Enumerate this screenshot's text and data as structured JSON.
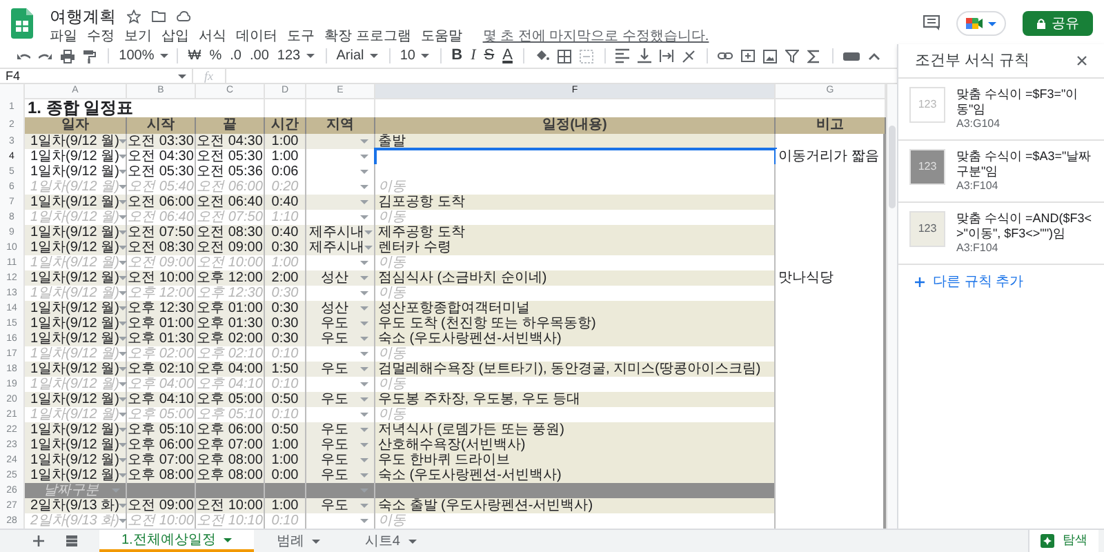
{
  "document": {
    "title": "여행계획",
    "last_edit": "몇 초 전에 마지막으로 수정했습니다."
  },
  "menu": [
    "파일",
    "수정",
    "보기",
    "삽입",
    "서식",
    "데이터",
    "도구",
    "확장 프로그램",
    "도움말"
  ],
  "share_button": "공유",
  "toolbar": {
    "zoom": "100%",
    "currency": "₩",
    "percent": "%",
    "decrease_decimal": ".0",
    "increase_decimal": ".00",
    "number_format": "123",
    "font": "Arial",
    "font_size": "10",
    "bold": "B",
    "italic": "I",
    "strike": "S",
    "text_color": "A"
  },
  "formula_bar": {
    "name_box": "F4",
    "fx": "fx"
  },
  "sheet": {
    "columns": [
      {
        "letter": "A",
        "selected": false
      },
      {
        "letter": "B",
        "selected": false
      },
      {
        "letter": "C",
        "selected": false
      },
      {
        "letter": "D",
        "selected": false
      },
      {
        "letter": "E",
        "selected": false
      },
      {
        "letter": "F",
        "selected": true
      },
      {
        "letter": "G",
        "selected": false
      }
    ],
    "title_row": {
      "number": "1",
      "text": "1. 종합 일정표"
    },
    "header_row": {
      "number": "2",
      "cells": [
        "일자",
        "시작",
        "끝",
        "시간",
        "지역",
        "일정(내용)",
        "비고"
      ]
    },
    "rows": [
      {
        "number": "3",
        "kind": "schedule",
        "date": "1일차(9/12 월)",
        "start": "오전 03:30",
        "end": "오전 04:30",
        "duration": "1:00",
        "plan": "출발",
        "selected": false
      },
      {
        "number": "4",
        "kind": "blank",
        "date": "1일차(9/12 월)",
        "start": "오전 04:30",
        "end": "오전 05:30",
        "duration": "1:00",
        "note": "이동거리가 짧음",
        "selected": true
      },
      {
        "number": "5",
        "kind": "blank",
        "date": "1일차(9/12 월)",
        "start": "오전 05:30",
        "end": "오전 05:36",
        "duration": "0:06",
        "selected": false
      },
      {
        "number": "6",
        "kind": "move",
        "date": "1일차(9/12 월)",
        "start": "오전 05:40",
        "end": "오전 06:00",
        "duration": "0:20",
        "plan": "이동",
        "selected": false
      },
      {
        "number": "7",
        "kind": "schedule",
        "date": "1일차(9/12 월)",
        "start": "오전 06:00",
        "end": "오전 06:40",
        "duration": "0:40",
        "plan": "김포공항 도착",
        "selected": false
      },
      {
        "number": "8",
        "kind": "move",
        "date": "1일차(9/12 월)",
        "start": "오전 06:40",
        "end": "오전 07:50",
        "duration": "1:10",
        "plan": "이동",
        "selected": false
      },
      {
        "number": "9",
        "kind": "schedule",
        "date": "1일차(9/12 월)",
        "start": "오전 07:50",
        "end": "오전 08:30",
        "duration": "0:40",
        "region": "제주시내",
        "plan": "제주공항 도착",
        "selected": false
      },
      {
        "number": "10",
        "kind": "schedule",
        "date": "1일차(9/12 월)",
        "start": "오전 08:30",
        "end": "오전 09:00",
        "duration": "0:30",
        "region": "제주시내",
        "plan": "렌터카 수령",
        "selected": false
      },
      {
        "number": "11",
        "kind": "move",
        "date": "1일차(9/12 월)",
        "start": "오전 09:00",
        "end": "오전 10:00",
        "duration": "1:00",
        "plan": "이동",
        "selected": false
      },
      {
        "number": "12",
        "kind": "schedule",
        "date": "1일차(9/12 월)",
        "start": "오전 10:00",
        "end": "오후 12:00",
        "duration": "2:00",
        "region": "성산",
        "plan": "점심식사 (소금바치 순이네)",
        "note": "맛나식당",
        "selected": false
      },
      {
        "number": "13",
        "kind": "move",
        "date": "1일차(9/12 월)",
        "start": "오후 12:00",
        "end": "오후 12:30",
        "duration": "0:30",
        "plan": "이동",
        "selected": false
      },
      {
        "number": "14",
        "kind": "schedule",
        "date": "1일차(9/12 월)",
        "start": "오후 12:30",
        "end": "오후 01:00",
        "duration": "0:30",
        "region": "성산",
        "plan": "성산포항종합여객터미널",
        "selected": false
      },
      {
        "number": "15",
        "kind": "schedule",
        "date": "1일차(9/12 월)",
        "start": "오후 01:00",
        "end": "오후 01:30",
        "duration": "0:30",
        "region": "우도",
        "plan": "우도 도착 (천진항 또는 하우목동항)",
        "selected": false
      },
      {
        "number": "16",
        "kind": "schedule",
        "date": "1일차(9/12 월)",
        "start": "오후 01:30",
        "end": "오후 02:00",
        "duration": "0:30",
        "region": "우도",
        "plan": "숙소 (우도사랑펜션-서빈백사)",
        "selected": false
      },
      {
        "number": "17",
        "kind": "move",
        "date": "1일차(9/12 월)",
        "start": "오후 02:00",
        "end": "오후 02:10",
        "duration": "0:10",
        "plan": "이동",
        "selected": false
      },
      {
        "number": "18",
        "kind": "schedule",
        "date": "1일차(9/12 월)",
        "start": "오후 02:10",
        "end": "오후 04:00",
        "duration": "1:50",
        "region": "우도",
        "plan": "검멀레해수욕장 (보트타기), 동안경굴, 지미스(땅콩아이스크림)",
        "selected": false
      },
      {
        "number": "19",
        "kind": "move",
        "date": "1일차(9/12 월)",
        "start": "오후 04:00",
        "end": "오후 04:10",
        "duration": "0:10",
        "plan": "이동",
        "selected": false
      },
      {
        "number": "20",
        "kind": "schedule",
        "date": "1일차(9/12 월)",
        "start": "오후 04:10",
        "end": "오후 05:00",
        "duration": "0:50",
        "region": "우도",
        "plan": "우도봉 주차장, 우도봉, 우도 등대",
        "selected": false
      },
      {
        "number": "21",
        "kind": "move",
        "date": "1일차(9/12 월)",
        "start": "오후 05:00",
        "end": "오후 05:10",
        "duration": "0:10",
        "plan": "이동",
        "selected": false
      },
      {
        "number": "22",
        "kind": "schedule",
        "date": "1일차(9/12 월)",
        "start": "오후 05:10",
        "end": "오후 06:00",
        "duration": "0:50",
        "region": "우도",
        "plan": "저녁식사 (로뎀가든 또는 풍원)",
        "selected": false
      },
      {
        "number": "23",
        "kind": "schedule",
        "date": "1일차(9/12 월)",
        "start": "오후 06:00",
        "end": "오후 07:00",
        "duration": "1:00",
        "region": "우도",
        "plan": "산호해수욕장(서빈백사)",
        "selected": false
      },
      {
        "number": "24",
        "kind": "schedule",
        "date": "1일차(9/12 월)",
        "start": "오후 07:00",
        "end": "오후 08:00",
        "duration": "1:00",
        "region": "우도",
        "plan": "우도 한바퀴 드라이브",
        "selected": false
      },
      {
        "number": "25",
        "kind": "schedule",
        "date": "1일차(9/12 월)",
        "start": "오후 08:00",
        "end": "오후 08:00",
        "duration": "0:00",
        "region": "우도",
        "plan": "숙소 (우도사랑펜션-서빈백사)",
        "selected": false
      },
      {
        "number": "26",
        "kind": "divider",
        "date": "날짜구분",
        "selected": false
      },
      {
        "number": "27",
        "kind": "schedule",
        "date": "2일차(9/13 화)",
        "start": "오전 09:00",
        "end": "오전 10:00",
        "duration": "1:00",
        "region": "우도",
        "plan": "숙소 출발 (우도사랑펜션-서빈백사)",
        "selected": false
      },
      {
        "number": "28",
        "kind": "move",
        "date": "2일차(9/13 화)",
        "start": "오전 10:00",
        "end": "오전 10:10",
        "duration": "0:10",
        "plan": "이동",
        "selected": false
      }
    ]
  },
  "panel": {
    "title": "조건부 서식 규칙",
    "rules": [
      {
        "sample": "123",
        "color": "#ffffff",
        "rule": "맞춤 수식이 =$F3=\"이동\"임",
        "range": "A3:G104"
      },
      {
        "sample": "123",
        "color": "#8e8e8e",
        "rule": "맞춤 수식이 =$A3=\"날짜구분\"임",
        "range": "A3:F104"
      },
      {
        "sample": "123",
        "color": "#edece2",
        "rule": "맞춤 수식이 =AND($F3<>\"이동\", $F3<>\"\")임",
        "range": "A3:F104"
      }
    ],
    "add_rule": "다른 규칙 추가"
  },
  "sheet_tabs": [
    {
      "label": "1.전체예상일정",
      "selected": true
    },
    {
      "label": "범례",
      "selected": false
    },
    {
      "label": "시트4",
      "selected": false
    }
  ],
  "explore": "탐색"
}
